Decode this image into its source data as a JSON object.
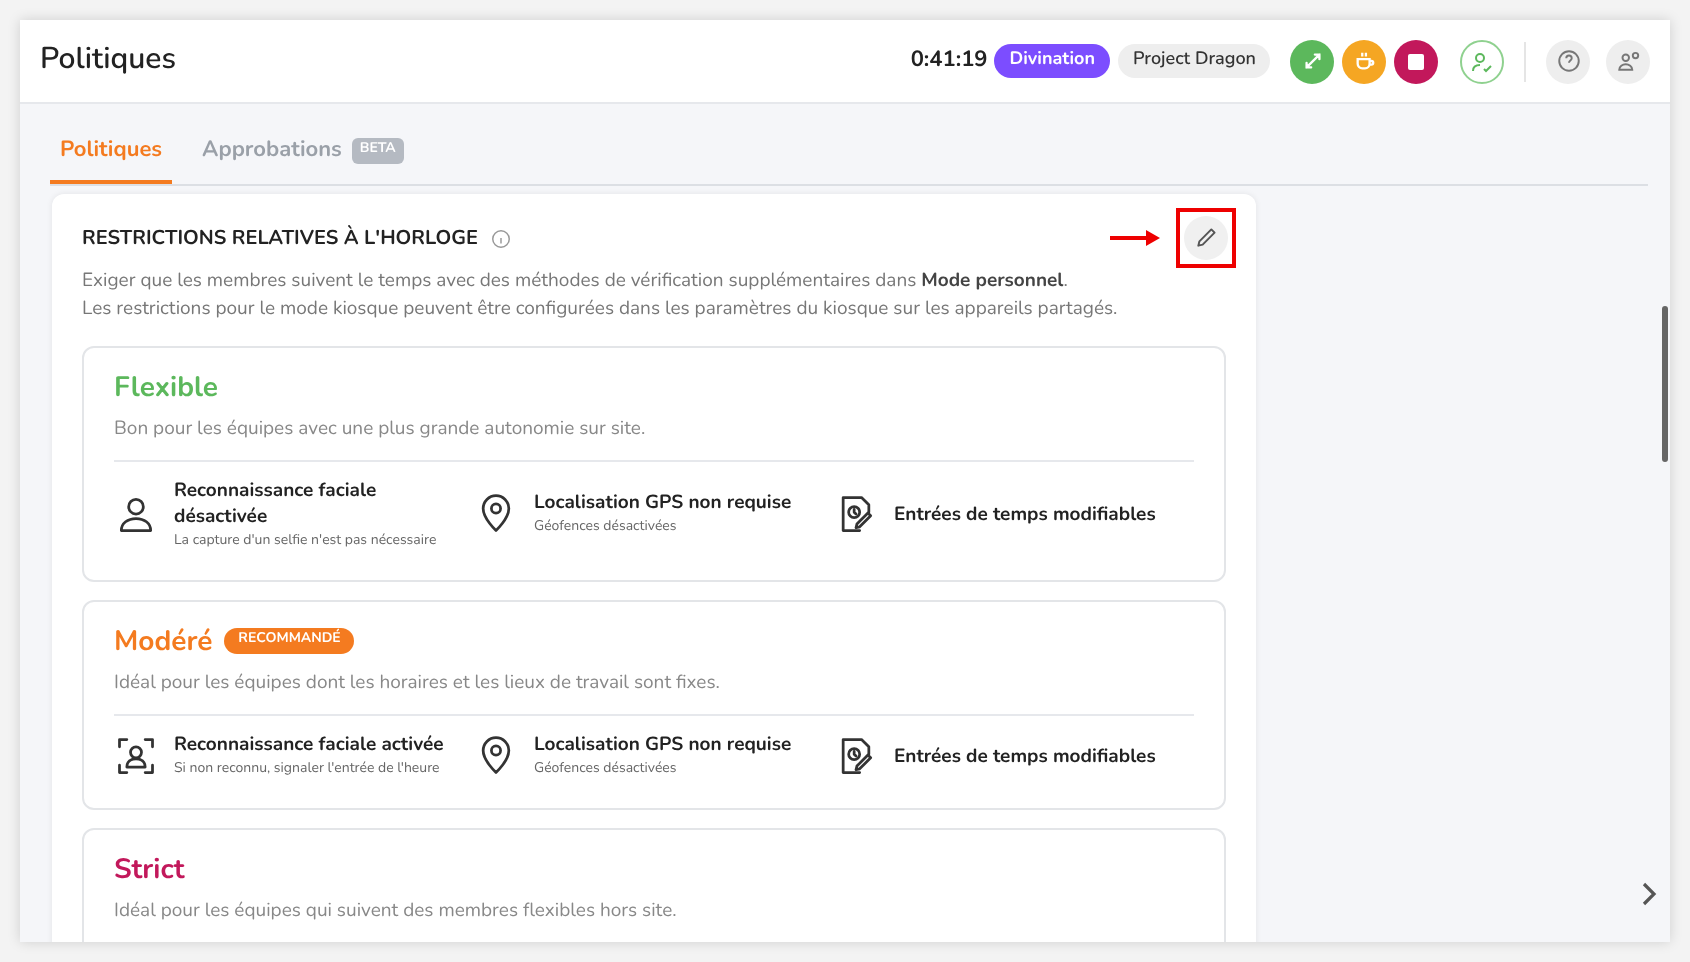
{
  "header": {
    "title": "Politiques",
    "timer": "0:41:19",
    "activity": "Divination",
    "project": "Project Dragon"
  },
  "tabs": [
    {
      "label": "Politiques",
      "selected": true
    },
    {
      "label": "Approbations",
      "selected": false,
      "badge": "BETA"
    }
  ],
  "section": {
    "title": "RESTRICTIONS RELATIVES À L'HORLOGE",
    "description": [
      "Exiger que les membres suivent le temps avec des méthodes de vérification supplémentaires dans **Mode personnel**.",
      "Les restrictions pour le mode kiosque peuvent être configurées dans les paramètres du kiosque sur les appareils partagés."
    ]
  },
  "policies": [
    {
      "name": "Flexible",
      "color": "#5cb85c",
      "description": "Bon pour les équipes avec une plus grande autonomie sur site.",
      "features": [
        {
          "kind": "face-off",
          "title": "Reconnaissance faciale désactivée",
          "subtitle": "La capture d'un selfie n'est pas nécessaire"
        },
        {
          "kind": "gps",
          "title": "Localisation GPS non requise",
          "subtitle": "Géofences désactivées"
        },
        {
          "kind": "time-edit",
          "title": "Entrées de temps modifiables"
        }
      ]
    },
    {
      "name": "Modéré",
      "color": "#f47b20",
      "badge": "RECOMMANDÉ",
      "description": "Idéal pour les équipes dont les horaires et les lieux de travail sont fixes.",
      "features": [
        {
          "kind": "face-scan",
          "title": "Reconnaissance faciale activée",
          "subtitle": "Si non reconnu, signaler l'entrée de l'heure"
        },
        {
          "kind": "gps",
          "title": "Localisation GPS non requise",
          "subtitle": "Géofences désactivées"
        },
        {
          "kind": "time-edit",
          "title": "Entrées de temps modifiables"
        }
      ]
    },
    {
      "name": "Strict",
      "color": "#c2185b",
      "description": "Idéal pour les équipes qui suivent des membres flexibles hors site."
    }
  ]
}
